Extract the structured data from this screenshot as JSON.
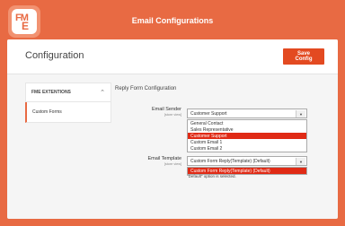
{
  "app": {
    "title": "Email Configurations",
    "logo_text_1": "FM",
    "logo_text_2": "E"
  },
  "header": {
    "page_title": "Configuration",
    "save_label": "Save Config"
  },
  "sidebar": {
    "section_label": "FME EXTENTIONS",
    "items": [
      {
        "label": "Custom Forms"
      }
    ]
  },
  "form": {
    "section_title": "Reply Form Configuration",
    "email_sender": {
      "label": "Email Sender",
      "scope": "[store view]",
      "value": "Customer Support",
      "options": [
        "General Contact",
        "Sales Representative",
        "Customer Support",
        "Custom Email 1",
        "Custom Email 2"
      ],
      "selected_index": 2
    },
    "email_template": {
      "label": "Email Template",
      "scope": "[store view]",
      "value": "Custom Form Reply(Template) (Default)",
      "options": [
        "Custom Form Reply(Template) (Default)"
      ],
      "selected_index": 0,
      "note": "\"Default\" option is selected."
    }
  }
}
